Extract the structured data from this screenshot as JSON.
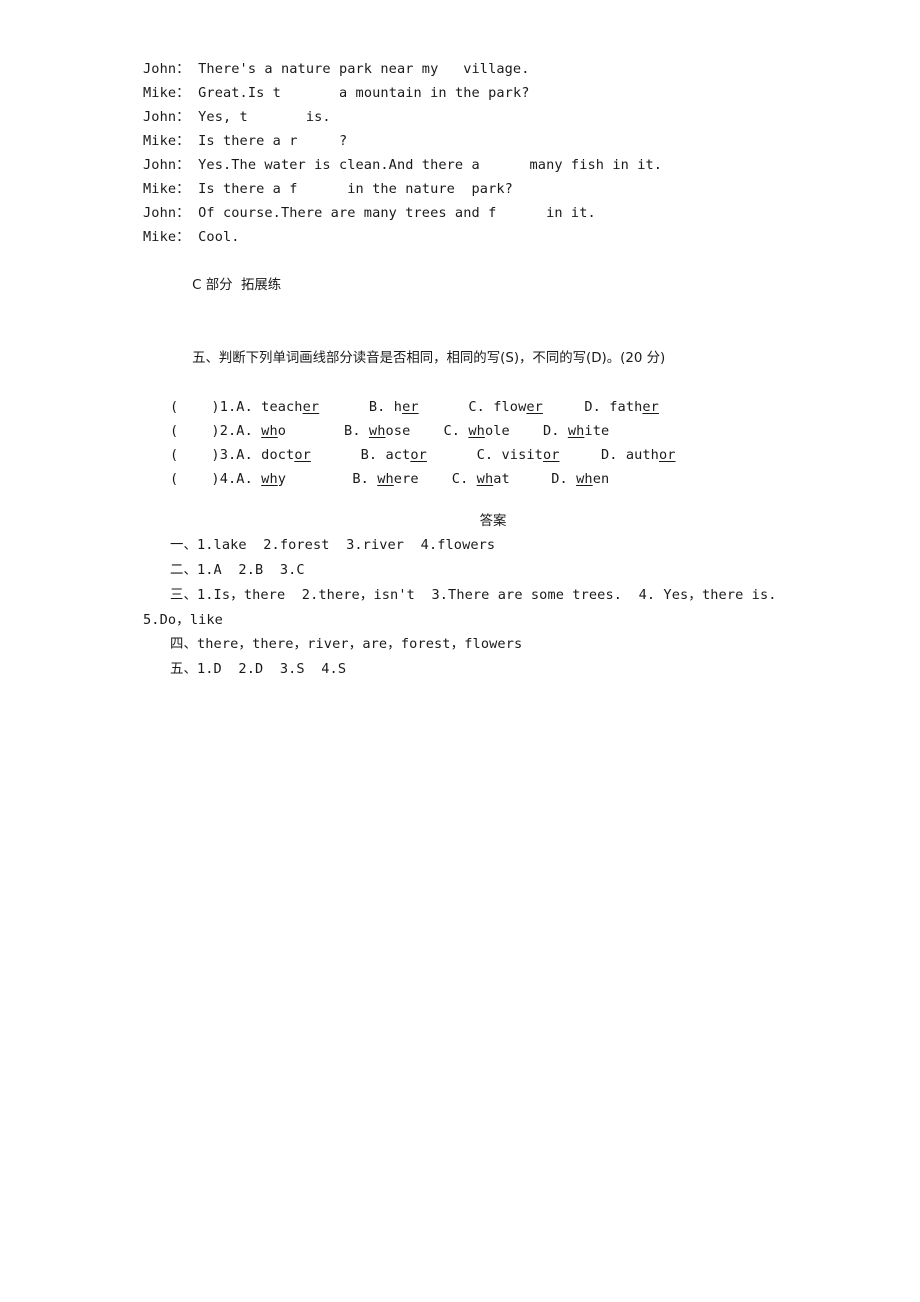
{
  "document": {
    "dialogue": {
      "name": "reading-dialogue",
      "lines": [
        {
          "speaker": "John：",
          "pre": "There's a nature park near my   village.",
          "blank": "",
          "post": ""
        },
        {
          "speaker": "Mike：",
          "pre": "Great.Is t",
          "blank": "______",
          "post": " a mountain in the park?"
        },
        {
          "speaker": "John：",
          "pre": "Yes, t",
          "blank": "______",
          "post": " is."
        },
        {
          "speaker": "Mike：",
          "pre": "Is there a r",
          "blank": "_____",
          "post": "?"
        },
        {
          "speaker": "John：",
          "pre": "Yes.The water is clean.And there a",
          "blank": "_____",
          "post": " many fish in it."
        },
        {
          "speaker": "Mike：",
          "pre": "Is there a f",
          "blank": "_____",
          "post": " in the nature  park?"
        },
        {
          "speaker": "John：",
          "pre": "Of course.There are many trees and f",
          "blank": "_____",
          "post": " in it."
        },
        {
          "speaker": "Mike：",
          "pre": "Cool.",
          "blank": "",
          "post": ""
        }
      ]
    },
    "part_c": {
      "label": "C 部分  拓展练",
      "section_five": {
        "heading": "五、判断下列单词画线部分读音是否相同，相同的写(S)，不同的写(D)。(20 分)",
        "items": [
          {
            "bracket": "(    )",
            "number": "1.",
            "options": [
              {
                "letter": "A.",
                "pre": "teach",
                "mark": "er",
                "post": "",
                "gap": "      "
              },
              {
                "letter": "B.",
                "pre": "h",
                "mark": "er",
                "post": "",
                "gap": "      "
              },
              {
                "letter": "C.",
                "pre": "flow",
                "mark": "er",
                "post": "",
                "gap": "     "
              },
              {
                "letter": "D.",
                "pre": "fath",
                "mark": "er",
                "post": "",
                "gap": ""
              }
            ]
          },
          {
            "bracket": "(    )",
            "number": "2.",
            "options": [
              {
                "letter": "A.",
                "pre": "",
                "mark": "wh",
                "post": "o",
                "gap": "       "
              },
              {
                "letter": "B.",
                "pre": "",
                "mark": "wh",
                "post": "ose",
                "gap": "    "
              },
              {
                "letter": "C.",
                "pre": "",
                "mark": "wh",
                "post": "ole",
                "gap": "    "
              },
              {
                "letter": "D.",
                "pre": "",
                "mark": "wh",
                "post": "ite",
                "gap": ""
              }
            ]
          },
          {
            "bracket": "(    )",
            "number": "3.",
            "options": [
              {
                "letter": "A.",
                "pre": "doct",
                "mark": "or",
                "post": "",
                "gap": "      "
              },
              {
                "letter": "B.",
                "pre": "act",
                "mark": "or",
                "post": "",
                "gap": "      "
              },
              {
                "letter": "C.",
                "pre": "visit",
                "mark": "or",
                "post": "",
                "gap": "     "
              },
              {
                "letter": "D.",
                "pre": "auth",
                "mark": "or",
                "post": "",
                "gap": ""
              }
            ]
          },
          {
            "bracket": "(    )",
            "number": "4.",
            "options": [
              {
                "letter": "A.",
                "pre": "",
                "mark": "wh",
                "post": "y",
                "gap": "        "
              },
              {
                "letter": "B.",
                "pre": "",
                "mark": "wh",
                "post": "ere",
                "gap": "    "
              },
              {
                "letter": "C.",
                "pre": "",
                "mark": "wh",
                "post": "at",
                "gap": "     "
              },
              {
                "letter": "D.",
                "pre": "",
                "mark": "wh",
                "post": "en",
                "gap": ""
              }
            ]
          }
        ]
      }
    },
    "answers": {
      "title": "答案",
      "lines": [
        {
          "label": "一、",
          "text": "1.lake  2.forest  3.river  4.flowers",
          "indented": true
        },
        {
          "label": "二、",
          "text": "1.A  2.B  3.C",
          "indented": true
        },
        {
          "label": "三、",
          "text": "1.Is，there  2.there，isn't  3.There are some trees.  4. Yes，there is.",
          "indented": true
        },
        {
          "label": "",
          "text": "5.Do，like",
          "indented": false
        },
        {
          "label": "四、",
          "text": "there，there，river，are，forest，flowers",
          "indented": true
        },
        {
          "label": "五、",
          "text": "1.D  2.D  3.S  4.S",
          "indented": true
        }
      ]
    }
  }
}
